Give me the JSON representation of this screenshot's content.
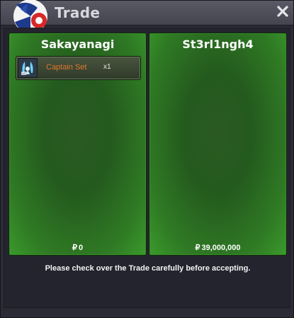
{
  "window": {
    "title": "Trade"
  },
  "left_panel": {
    "player_name": "Sakayanagi",
    "items": [
      {
        "name": "Captain Set",
        "quantity": "x1",
        "icon": "captain-set-icon"
      }
    ],
    "money_symbol": "₽",
    "money": "0"
  },
  "right_panel": {
    "player_name": "St3rl1ngh4",
    "items": [],
    "money_symbol": "₽",
    "money": "39,000,000"
  },
  "footer": {
    "notice": "Please check over the Trade carefully before accepting."
  },
  "colors": {
    "panel_green": "#2f7a24",
    "item_name_orange": "#e07a2a",
    "title_gray": "#d8d8de"
  }
}
